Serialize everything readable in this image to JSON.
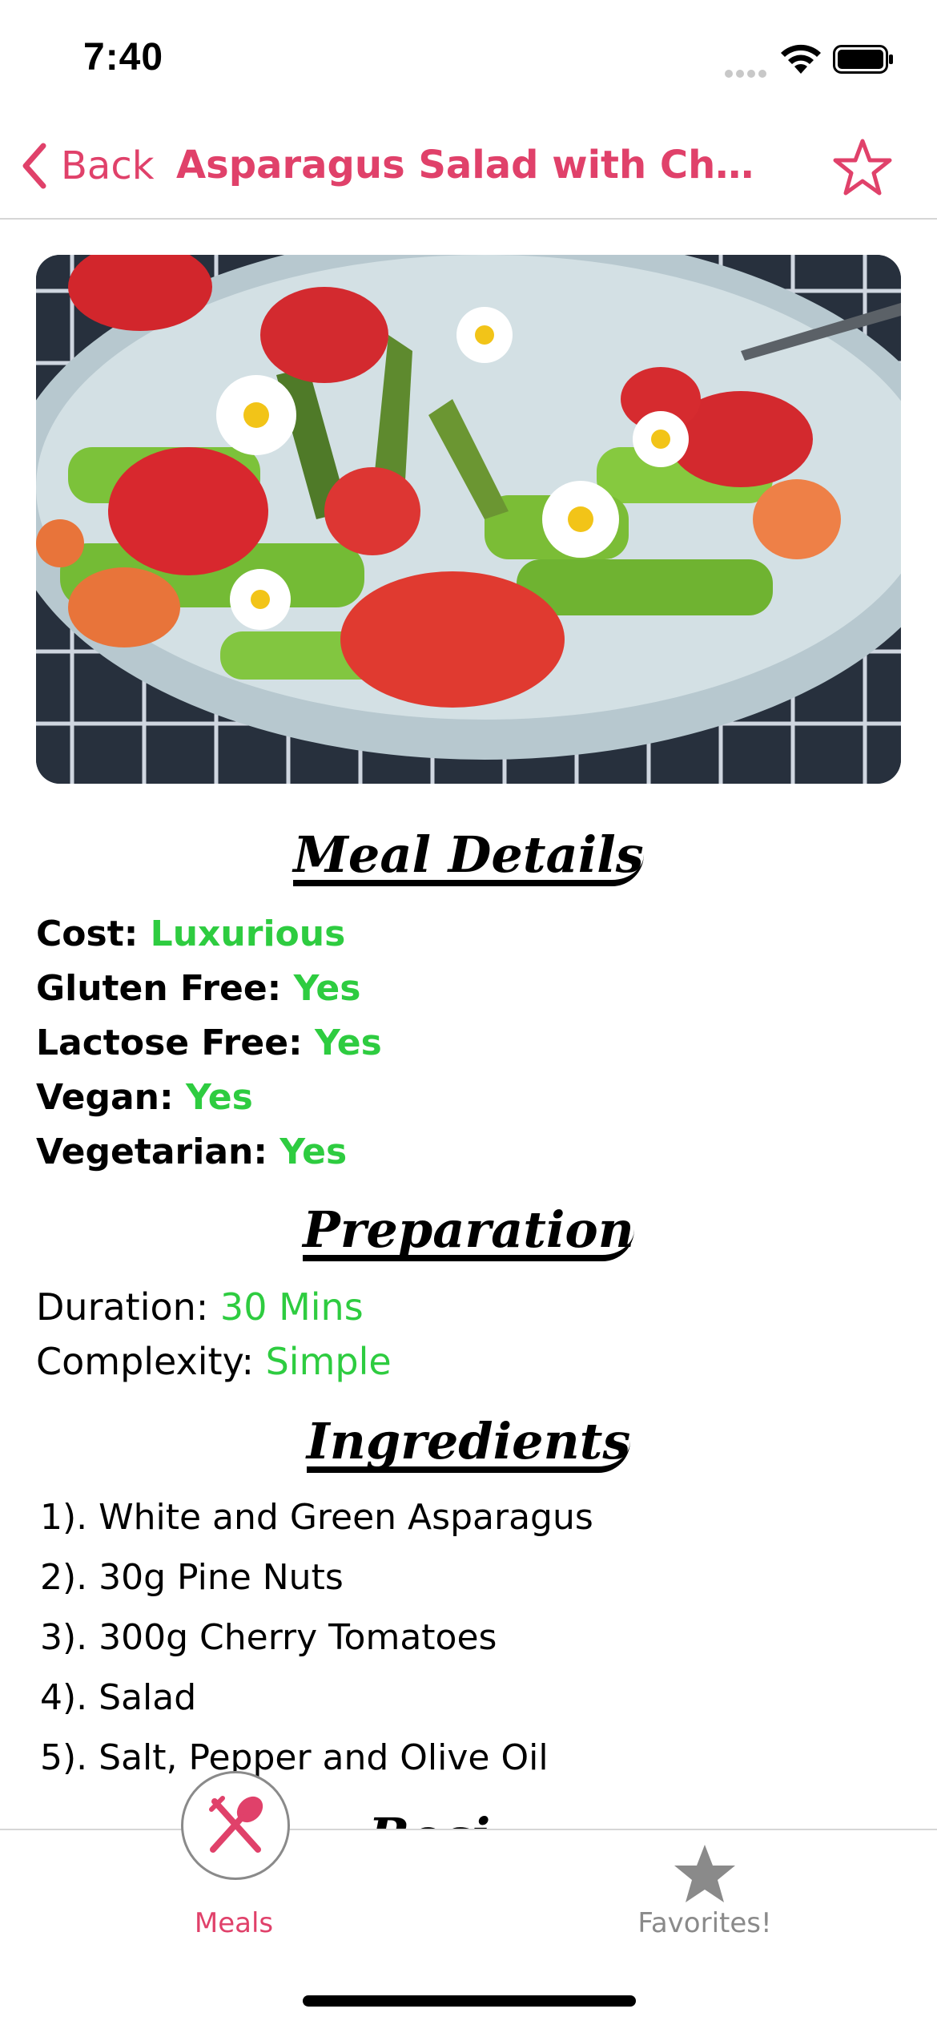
{
  "status_bar": {
    "time": "7:40"
  },
  "nav": {
    "back_label": "Back",
    "title": "Asparagus Salad with Cherry Tomatoes",
    "accent_color": "#e0416a"
  },
  "meal_details": {
    "heading": "Meal Details",
    "cost_label": "Cost:",
    "cost_value": "Luxurious",
    "gluten_label": "Gluten Free:",
    "gluten_value": "Yes",
    "lactose_label": "Lactose Free:",
    "lactose_value": "Yes",
    "vegan_label": "Vegan:",
    "vegan_value": "Yes",
    "vegetarian_label": "Vegetarian:",
    "vegetarian_value": "Yes",
    "value_color": "#2ecc40"
  },
  "preparation": {
    "heading": "Preparation",
    "duration_label": "Duration:",
    "duration_value": "30 Mins",
    "complexity_label": "Complexity:",
    "complexity_value": "Simple"
  },
  "ingredients": {
    "heading": "Ingredients",
    "items": [
      "1). White and Green Asparagus",
      "2). 30g Pine Nuts",
      "3). 300g Cherry Tomatoes",
      "4). Salad",
      "5). Salt, Pepper and Olive Oil"
    ]
  },
  "next_section_peek": "Reci",
  "tab_bar": {
    "meals_label": "Meals",
    "favorites_label": "Favorites!",
    "meals_icon": "fork-spoon-icon",
    "favorites_icon": "star-icon"
  }
}
